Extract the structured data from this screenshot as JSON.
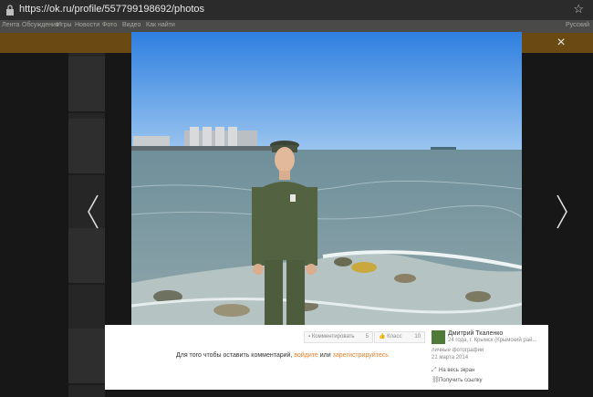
{
  "browser": {
    "url": "https://ok.ru/profile/557799198692/photos"
  },
  "site_nav": {
    "items": [
      "Лента",
      "Обсуждения",
      "Игры",
      "Новости",
      "Фото",
      "Видео",
      "Как найти"
    ],
    "right": "Русский"
  },
  "viewer": {
    "close_glyph": "×",
    "stats": {
      "comment_label": "Комментировать",
      "comment_count": "5",
      "class_label": "Класс",
      "class_count": "10"
    },
    "comment_prompt": {
      "before": "Для того чтобы оставить комментарий, ",
      "login_link": "войдите",
      "middle": " или ",
      "register_link": "зарегистрируйтесь"
    },
    "author": {
      "name": "Дмитрий Ткаленко",
      "location": "24 года, г. Крымск (Крымский рай..."
    },
    "album": "личные фотографии",
    "date": "21 марта 2014",
    "actions": {
      "fullscreen": "На весь экран",
      "get_link": "Получить ссылку"
    }
  },
  "colors": {
    "accent_orange": "#ed812b",
    "sky": "#3f8ce0",
    "sea": "#7f9aa3"
  }
}
